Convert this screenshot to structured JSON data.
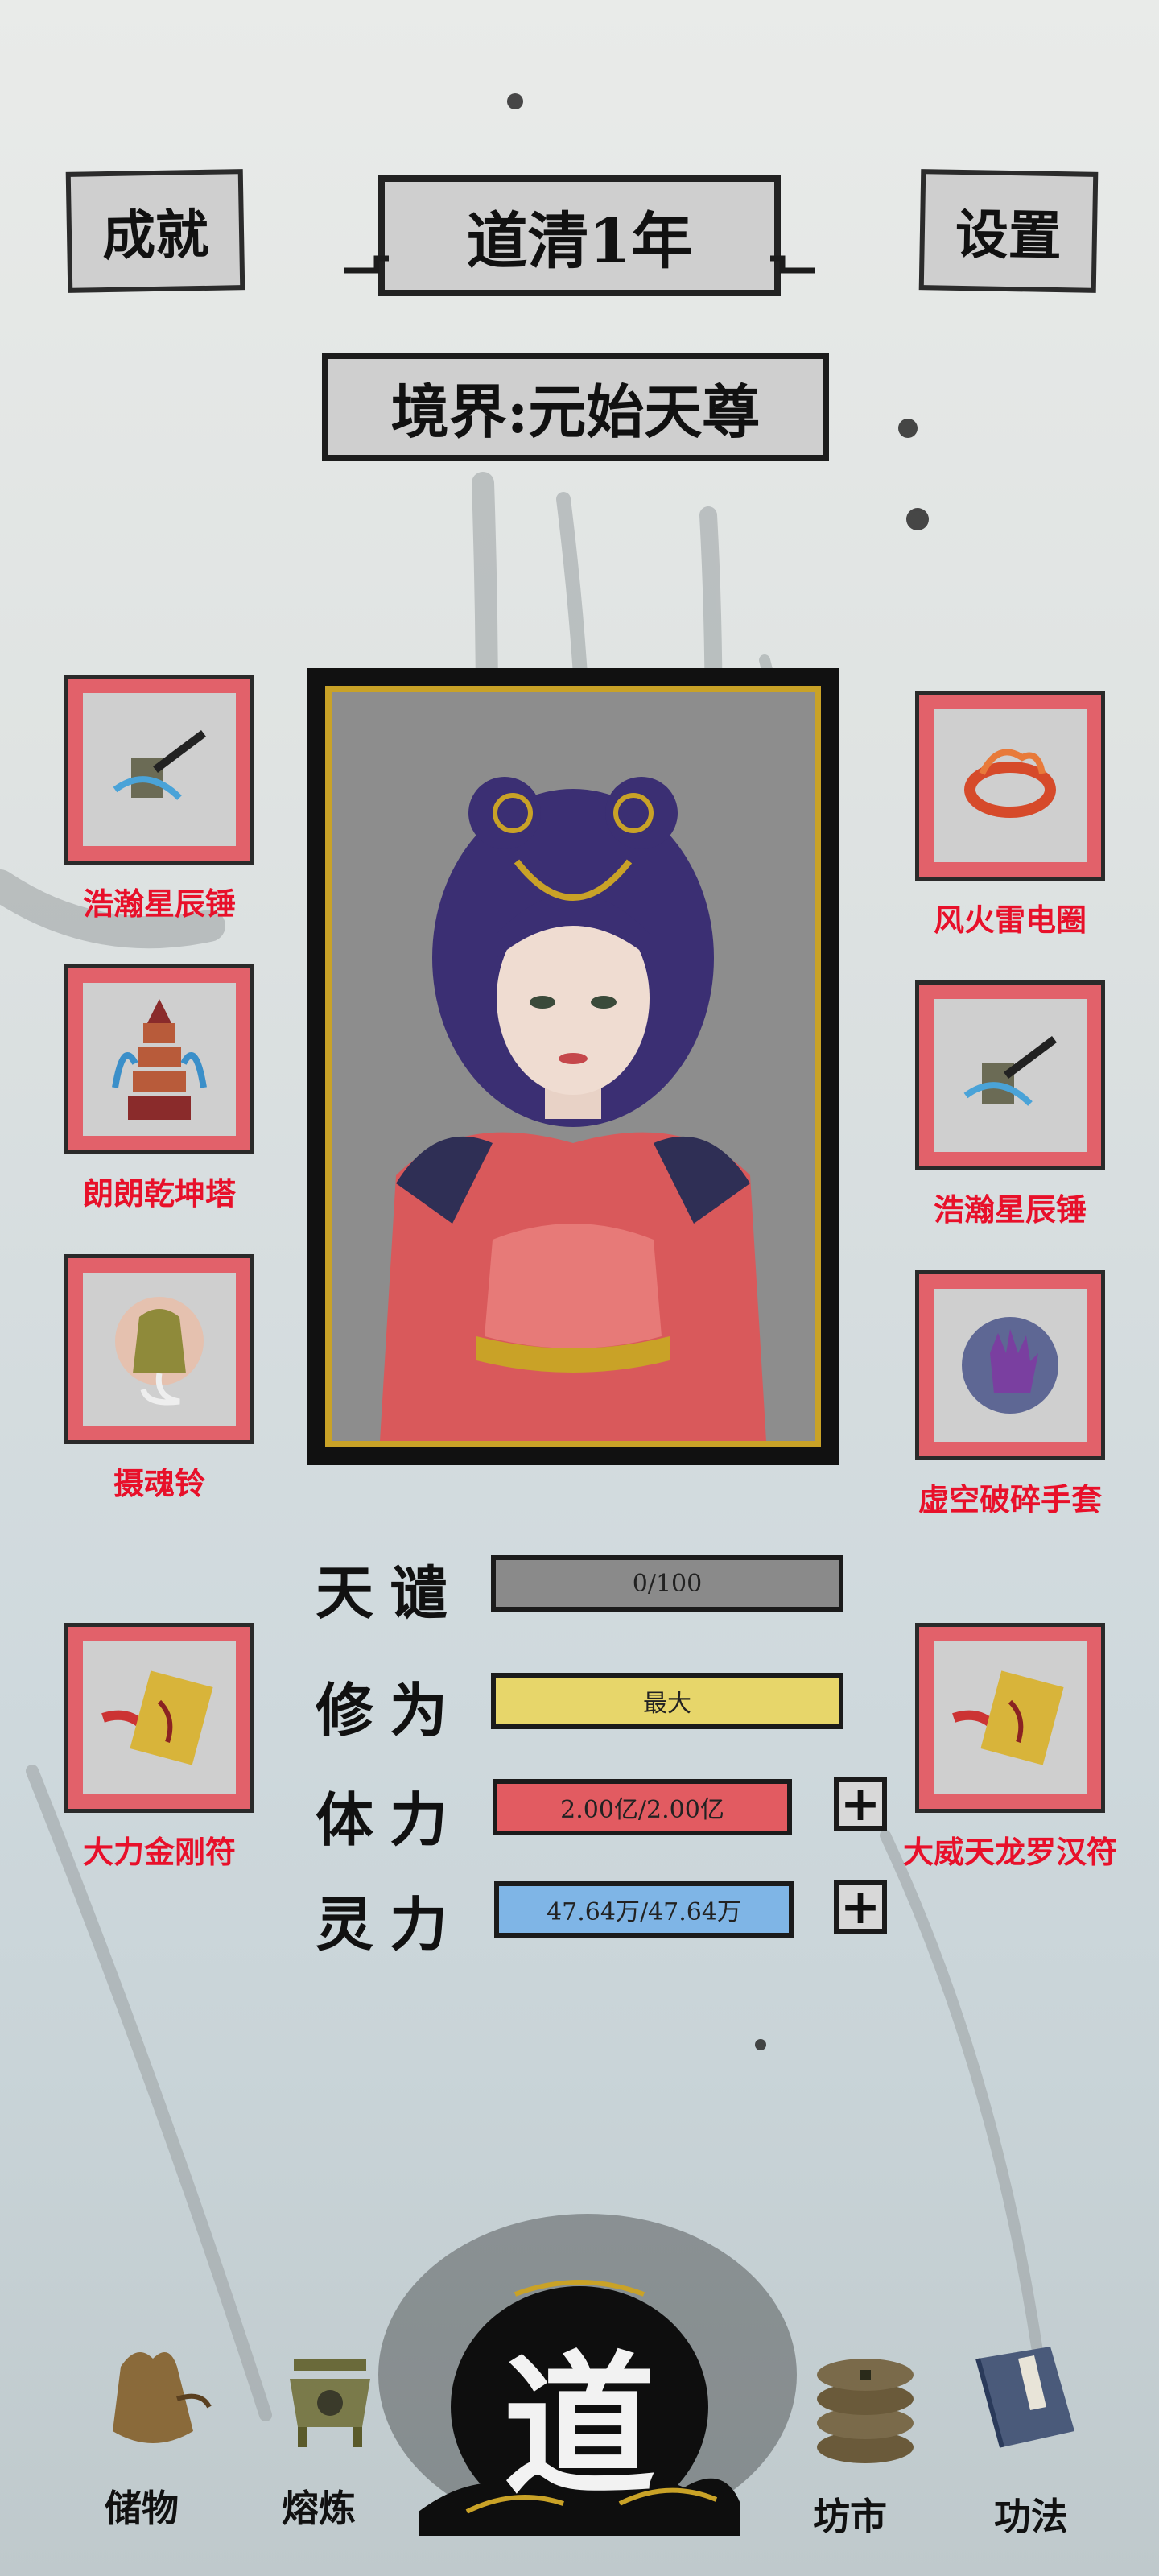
{
  "header": {
    "achievements_label": "成就",
    "year_title": "道清1年",
    "settings_label": "设置",
    "realm_title": "境界:元始天尊"
  },
  "left_slots": [
    {
      "name": "浩瀚星辰锤",
      "icon": "hammer-icon"
    },
    {
      "name": "朗朗乾坤塔",
      "icon": "pagoda-icon"
    },
    {
      "name": "摄魂铃",
      "icon": "bell-icon"
    },
    {
      "name": "大力金刚符",
      "icon": "talisman-icon"
    }
  ],
  "right_slots": [
    {
      "name": "风火雷电圈",
      "icon": "fire-ring-icon"
    },
    {
      "name": "浩瀚星辰锤",
      "icon": "hammer-icon"
    },
    {
      "name": "虚空破碎手套",
      "icon": "glove-icon"
    },
    {
      "name": "大威天龙罗汉符",
      "icon": "talisman-icon"
    }
  ],
  "stats": [
    {
      "label": "天谴",
      "value": "0/100",
      "color": "#8a8a8a"
    },
    {
      "label": "修为",
      "value": "最大",
      "color": "#e7d66a"
    },
    {
      "label": "体力",
      "value": "2.00亿/2.00亿",
      "color": "#e25b61"
    },
    {
      "label": "灵力",
      "value": "47.64万/47.64万",
      "color": "#7fb5e6"
    }
  ],
  "plus_label": "+",
  "nav": {
    "storage": "储物",
    "smelt": "熔炼",
    "center": "道",
    "market": "坊市",
    "skills": "功法"
  },
  "colors": {
    "slot_border": "#e2616a",
    "label_red": "#e8102a",
    "gold": "#c9a227"
  }
}
